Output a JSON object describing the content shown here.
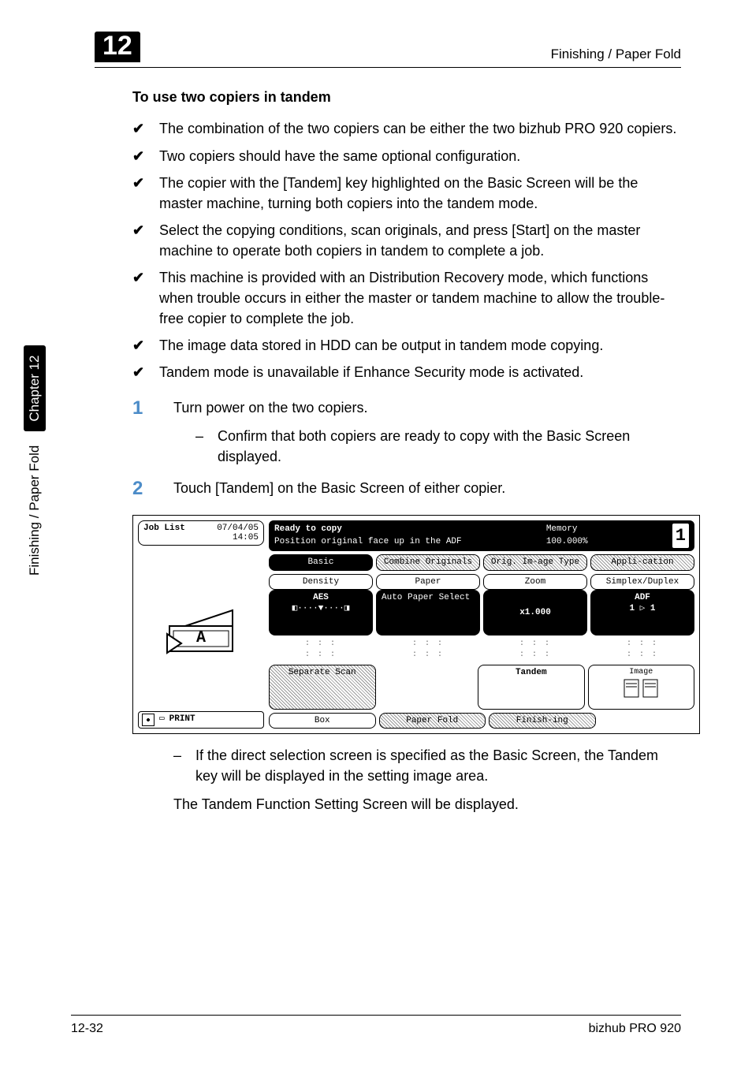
{
  "header": {
    "chapter_number": "12",
    "breadcrumb": "Finishing / Paper Fold"
  },
  "section": {
    "heading": "To use two copiers in tandem"
  },
  "bullets": [
    "The combination of the two copiers can be either the two bizhub PRO 920 copiers.",
    "Two copiers should have the same optional configuration.",
    "The copier with the [Tandem] key highlighted on the Basic Screen will be the master machine, turning both copiers into the tandem mode.",
    "Select the copying conditions, scan originals, and press [Start] on the master machine to operate both copiers in tandem to complete a job.",
    "This machine is provided with an Distribution Recovery mode, which functions when trouble occurs in either the master or tandem machine to allow the trouble-free copier to complete the job.",
    "The image data stored in HDD can be output in tandem mode copying.",
    "Tandem mode is unavailable if Enhance Security mode is activated."
  ],
  "steps": [
    {
      "num": "1",
      "text": "Turn power on the two copiers.",
      "sub": "Confirm that both copiers are ready to copy with the Basic Screen displayed."
    },
    {
      "num": "2",
      "text": "Touch [Tandem] on the Basic Screen of either copier."
    }
  ],
  "screenshot": {
    "job_list": "Job List",
    "date": "07/04/05",
    "time": "14:05",
    "status1": "Ready to copy",
    "status2": "Position original face up in the ADF",
    "memory_label": "Memory",
    "memory_value": "100.000%",
    "counter": "1",
    "tabs": {
      "basic": "Basic",
      "combine": "Combine Originals",
      "orig": "Orig. Im-age Type",
      "appli": "Appli-cation"
    },
    "cols": {
      "density_label": "Density",
      "density_value": "AES",
      "density_slider": "◧····▼····◨",
      "paper_label": "Paper",
      "paper_value": "Auto Paper Select",
      "zoom_label": "Zoom",
      "zoom_value": "x1.000",
      "simplex_label": "Simplex/Duplex",
      "adf": "ADF",
      "ratio": "1 ▷ 1"
    },
    "row2": {
      "separate": "Separate Scan",
      "tandem": "Tandem",
      "image": "Image"
    },
    "row3": {
      "box": "Box",
      "paperfold": "Paper Fold",
      "finishing": "Finish-ing"
    },
    "print": "PRINT"
  },
  "after": {
    "dash": "If the direct selection screen is specified as the Basic Screen, the Tandem key will be displayed in the setting image area.",
    "plain": "The Tandem Function Setting Screen will be displayed."
  },
  "sidetab": {
    "label": "Finishing / Paper Fold",
    "chapter": "Chapter 12"
  },
  "footer": {
    "page": "12-32",
    "model": "bizhub PRO 920"
  }
}
